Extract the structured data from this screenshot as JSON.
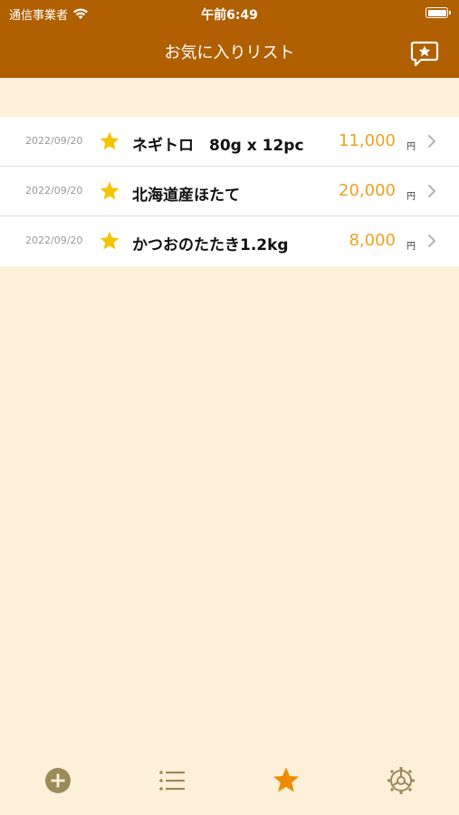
{
  "status": {
    "carrier": "通信事業者",
    "time": "午前6:49"
  },
  "header": {
    "title": "お気に入りリスト"
  },
  "items": [
    {
      "date": "2022/09/20",
      "name": "ネギトロ　80g x 12pc",
      "price": "11,000",
      "unit": "円"
    },
    {
      "date": "2022/09/20",
      "name": "北海道産ほたて",
      "price": "20,000",
      "unit": "円"
    },
    {
      "date": "2022/09/20",
      "name": "かつおのたたき1.2kg",
      "price": "8,000",
      "unit": "円"
    }
  ],
  "colors": {
    "header": "#b06000",
    "background": "#fdf0d8",
    "price": "#f0a020",
    "star": "#f5c400",
    "tab_active": "#f08a00",
    "tab_inactive": "#9b8a5a"
  },
  "tabs": [
    {
      "icon": "add-circle-icon",
      "active": false
    },
    {
      "icon": "list-icon",
      "active": false
    },
    {
      "icon": "star-icon",
      "active": true
    },
    {
      "icon": "settings-gear-icon",
      "active": false
    }
  ]
}
